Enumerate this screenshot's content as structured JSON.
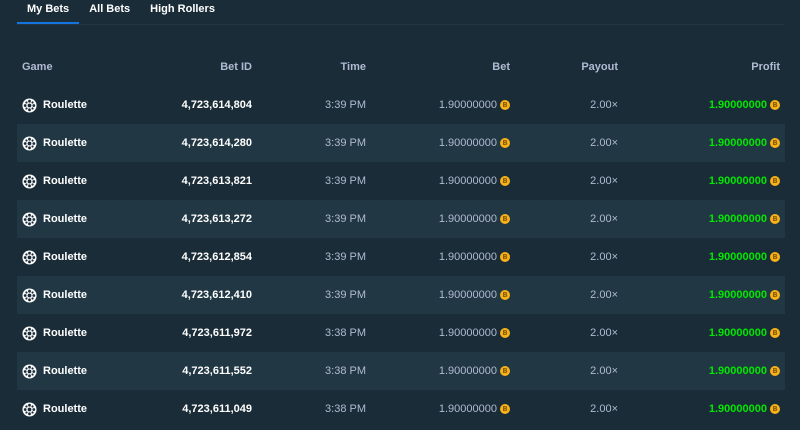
{
  "tabs": [
    {
      "label": "My Bets",
      "active": true
    },
    {
      "label": "All Bets",
      "active": false
    },
    {
      "label": "High Rollers",
      "active": false
    }
  ],
  "columns": {
    "game": "Game",
    "bet_id": "Bet ID",
    "time": "Time",
    "bet": "Bet",
    "payout": "Payout",
    "profit": "Profit"
  },
  "currency_icon": "coin-icon",
  "game_icon": "roulette-wheel-icon",
  "colors": {
    "accent": "#1475e1",
    "profit": "#00e701",
    "coin": "#f7b217",
    "row_alt": "#213743",
    "background": "#1a2c38"
  },
  "rows": [
    {
      "game": "Roulette",
      "bet_id": "4,723,614,804",
      "time": "3:39 PM",
      "bet": "1.90000000",
      "payout": "2.00×",
      "profit": "1.90000000"
    },
    {
      "game": "Roulette",
      "bet_id": "4,723,614,280",
      "time": "3:39 PM",
      "bet": "1.90000000",
      "payout": "2.00×",
      "profit": "1.90000000"
    },
    {
      "game": "Roulette",
      "bet_id": "4,723,613,821",
      "time": "3:39 PM",
      "bet": "1.90000000",
      "payout": "2.00×",
      "profit": "1.90000000"
    },
    {
      "game": "Roulette",
      "bet_id": "4,723,613,272",
      "time": "3:39 PM",
      "bet": "1.90000000",
      "payout": "2.00×",
      "profit": "1.90000000"
    },
    {
      "game": "Roulette",
      "bet_id": "4,723,612,854",
      "time": "3:39 PM",
      "bet": "1.90000000",
      "payout": "2.00×",
      "profit": "1.90000000"
    },
    {
      "game": "Roulette",
      "bet_id": "4,723,612,410",
      "time": "3:39 PM",
      "bet": "1.90000000",
      "payout": "2.00×",
      "profit": "1.90000000"
    },
    {
      "game": "Roulette",
      "bet_id": "4,723,611,972",
      "time": "3:38 PM",
      "bet": "1.90000000",
      "payout": "2.00×",
      "profit": "1.90000000"
    },
    {
      "game": "Roulette",
      "bet_id": "4,723,611,552",
      "time": "3:38 PM",
      "bet": "1.90000000",
      "payout": "2.00×",
      "profit": "1.90000000"
    },
    {
      "game": "Roulette",
      "bet_id": "4,723,611,049",
      "time": "3:38 PM",
      "bet": "1.90000000",
      "payout": "2.00×",
      "profit": "1.90000000"
    }
  ]
}
